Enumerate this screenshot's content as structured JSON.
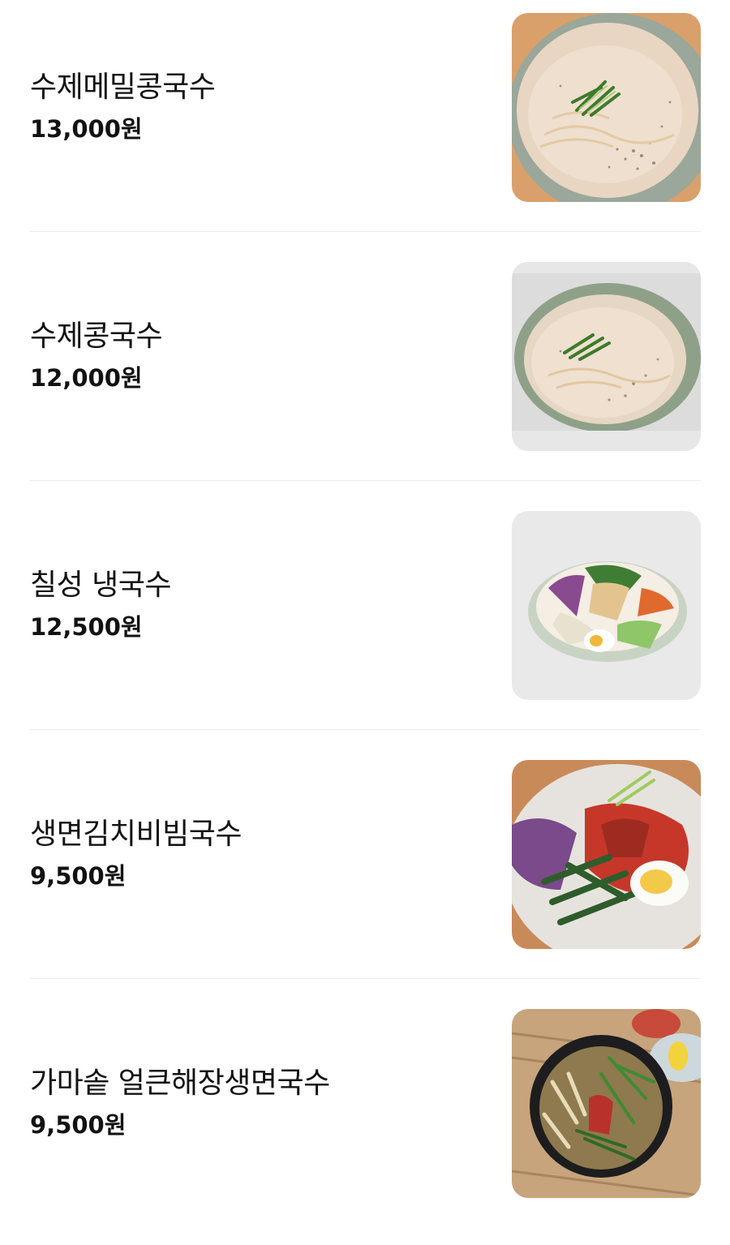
{
  "menu": {
    "items": [
      {
        "name": "수제메밀콩국수",
        "price": "13,000원",
        "photo": "buckwheat-soy-noodle-photo"
      },
      {
        "name": "수제콩국수",
        "price": "12,000원",
        "photo": "soy-noodle-photo"
      },
      {
        "name": "칠성 냉국수",
        "price": "12,500원",
        "photo": "cold-noodle-photo"
      },
      {
        "name": "생면김치비빔국수",
        "price": "9,500원",
        "photo": "kimchi-bibim-noodle-photo"
      },
      {
        "name": "가마솥 얼큰해장생면국수",
        "price": "9,500원",
        "photo": "spicy-haejang-noodle-photo"
      }
    ]
  }
}
